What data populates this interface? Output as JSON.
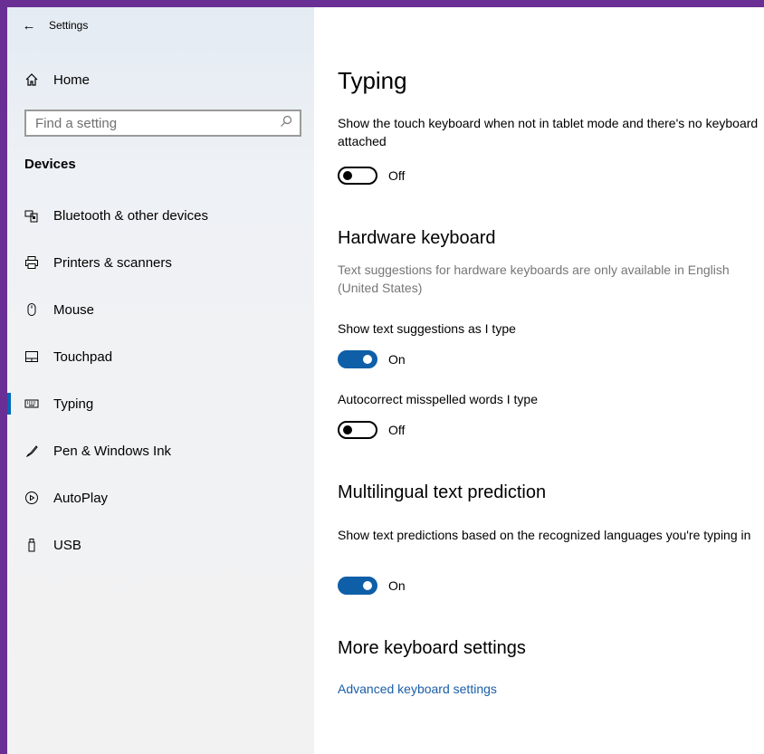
{
  "window": {
    "title": "Settings"
  },
  "sidebar": {
    "home_label": "Home",
    "search_placeholder": "Find a setting",
    "section_title": "Devices",
    "items": [
      {
        "label": "Bluetooth & other devices",
        "icon": "bluetooth-devices-icon"
      },
      {
        "label": "Printers & scanners",
        "icon": "printer-icon"
      },
      {
        "label": "Mouse",
        "icon": "mouse-icon"
      },
      {
        "label": "Touchpad",
        "icon": "touchpad-icon"
      },
      {
        "label": "Typing",
        "icon": "keyboard-icon",
        "active": true
      },
      {
        "label": "Pen & Windows Ink",
        "icon": "pen-icon"
      },
      {
        "label": "AutoPlay",
        "icon": "autoplay-icon"
      },
      {
        "label": "USB",
        "icon": "usb-icon"
      }
    ]
  },
  "main": {
    "title": "Typing",
    "touch_keyboard": {
      "description": "Show the touch keyboard when not in tablet mode and there's no keyboard attached",
      "state": "Off"
    },
    "hardware_keyboard": {
      "heading": "Hardware keyboard",
      "note": "Text suggestions for hardware keyboards are only available in English (United States)",
      "suggestions": {
        "label": "Show text suggestions as I type",
        "state": "On"
      },
      "autocorrect": {
        "label": "Autocorrect misspelled words I type",
        "state": "Off"
      }
    },
    "multilingual": {
      "heading": "Multilingual text prediction",
      "description": "Show text predictions based on the recognized languages you're typing in",
      "state": "On"
    },
    "more": {
      "heading": "More keyboard settings",
      "link": "Advanced keyboard settings"
    }
  },
  "colors": {
    "accent": "#0f5fa8",
    "link": "#1a5ea8",
    "frame": "#6a2f94"
  }
}
